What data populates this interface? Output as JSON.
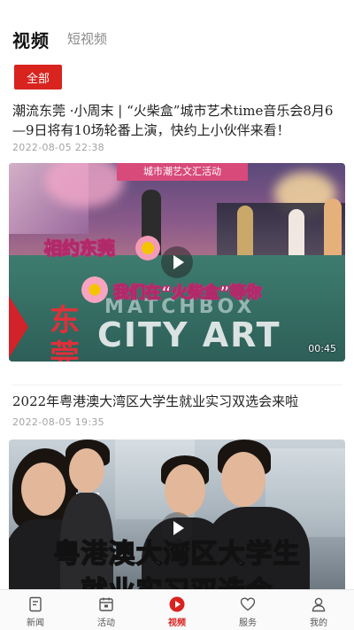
{
  "top_tabs": {
    "active": "视频",
    "secondary": "短视频"
  },
  "filter": {
    "chip_label": "全部"
  },
  "feed": [
    {
      "title": "潮流东莞 ·小周末 | “火柴盒”城市艺术time音乐会8月6—9日将有10场轮番上演，快约上小伙伴来看！",
      "date": "2022-08-05 22:38",
      "duration": "00:45",
      "overlay": {
        "banner": "城市潮艺文汇活动",
        "line1": "相约东莞",
        "line2": "我们在“火柴盒”等你",
        "big_left_1": "东",
        "big_left_2": "莞",
        "match": "MATCHBOX",
        "city_art": "CITY ART"
      }
    },
    {
      "title": "2022年粤港澳大湾区大学生就业实习双选会来啦",
      "date": "2022-08-05 19:35",
      "overlay": {
        "caption_line1": "粤港澳大湾区大学生",
        "caption_line2": "就业实习双选会"
      }
    }
  ],
  "bottom_nav": [
    {
      "label": "新闻",
      "icon": "news-icon"
    },
    {
      "label": "活动",
      "icon": "calendar-icon"
    },
    {
      "label": "视频",
      "icon": "play-icon",
      "active": true
    },
    {
      "label": "服务",
      "icon": "heart-icon"
    },
    {
      "label": "我的",
      "icon": "user-icon"
    }
  ],
  "colors": {
    "accent": "#d8231f",
    "text": "#222222",
    "muted": "#a4a4a4"
  }
}
